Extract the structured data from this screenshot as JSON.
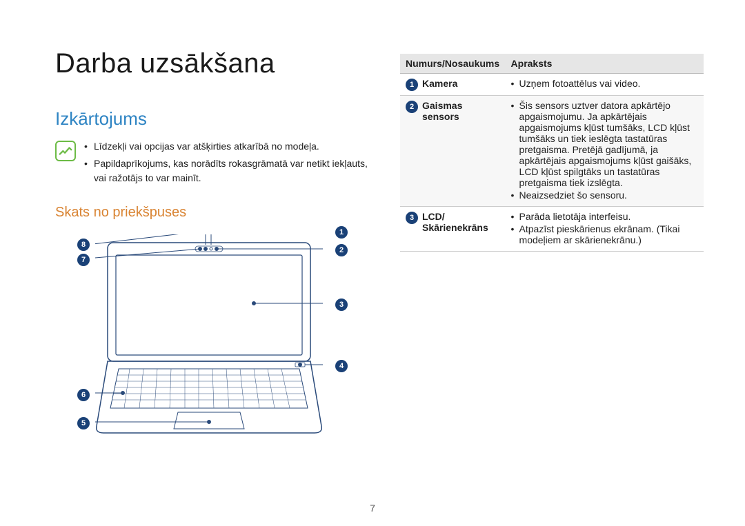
{
  "page_number": "7",
  "chapter_title": "Darba uzsākšana",
  "section_title": "Izkārtojums",
  "notes": [
    "Līdzekļi vai opcijas var atšķirties atkarībā no modeļa.",
    "Papildaprīkojums, kas norādīts rokasgrāmatā var netikt iekļauts, vai ražotājs to var mainīt."
  ],
  "subsection_title": "Skats no priekšpuses",
  "diagram": {
    "callouts": [
      {
        "n": "1"
      },
      {
        "n": "2"
      },
      {
        "n": "3"
      },
      {
        "n": "4"
      },
      {
        "n": "5"
      },
      {
        "n": "6"
      },
      {
        "n": "7"
      },
      {
        "n": "8"
      }
    ]
  },
  "table": {
    "headers": {
      "num_name": "Numurs/Nosaukums",
      "desc": "Apraksts"
    },
    "rows": [
      {
        "n": "1",
        "name": "Kamera",
        "desc": [
          "Uzņem fotoattēlus vai video."
        ]
      },
      {
        "n": "2",
        "name": "Gaismas sensors",
        "desc": [
          "Šis sensors uztver datora apkārtējo apgaismojumu. Ja apkārtējais apgaismojums kļūst tumšāks, LCD kļūst tumšāks un tiek ieslēgta tastatūras pretgaisma. Pretējā gadījumā, ja apkārtējais apgaismojums kļūst gaišāks, LCD kļūst spilgtāks un tastatūras pretgaisma tiek izslēgta.",
          "Neaizsedziet šo sensoru."
        ]
      },
      {
        "n": "3",
        "name": "LCD/\nSkārienekrāns",
        "desc": [
          "Parāda lietotāja interfeisu.",
          "Atpazīst pieskārienus ekrānam. (Tikai modeļiem ar skārienekrānu.)"
        ]
      }
    ]
  }
}
